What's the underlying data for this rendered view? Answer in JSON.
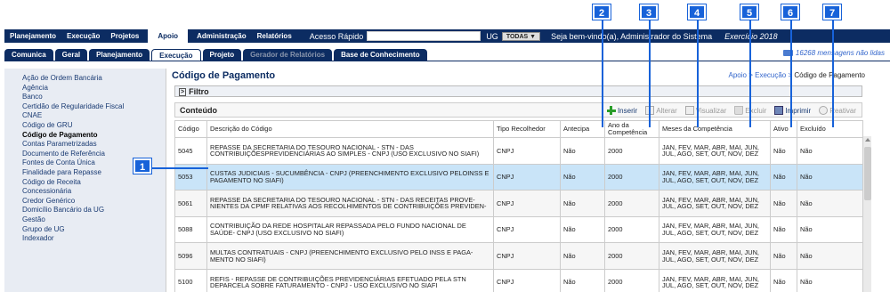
{
  "menu": [
    "Planejamento",
    "Execução",
    "Projetos",
    "Apoio",
    "Administração",
    "Relatórios"
  ],
  "active_menu": "Apoio",
  "quick_access_label": "Acesso Rápido",
  "ug_label": "UG",
  "ug_value": "TODAS ▼",
  "welcome": "Seja bem-vindo(a), Administrador do Sistema",
  "exercise": "Exercício 2018",
  "tabs": [
    "Comunica",
    "Geral",
    "Planejamento",
    "Execução",
    "Projeto",
    "Gerador de Relatórios",
    "Base de Conhecimento"
  ],
  "messages": "16268 mensagens não lidas",
  "sidebar": [
    "Ação de Ordem Bancária",
    "Agência",
    "Banco",
    "Certidão de Regularidade Fiscal",
    "CNAE",
    "Código de GRU",
    "Código de Pagamento",
    "Contas Parametrizadas",
    "Documento de Referência",
    "Fontes de Conta Única",
    "Finalidade para Repasse",
    "Código de Receita",
    "Concessionária",
    "Credor Genérico",
    "Domicílio Bancário da UG",
    "Gestão",
    "Grupo de UG",
    "Indexador"
  ],
  "page_title": "Código de Pagamento",
  "breadcrumb": {
    "p1": "Apoio",
    "sep": " > ",
    "p2": "Execução",
    "p3": "Código de Pagamento"
  },
  "filter_label": "Filtro",
  "content_label": "Conteúdo",
  "actions": [
    "Inserir",
    "Alterar",
    "Visualizar",
    "Excluir",
    "Imprimir",
    "Reativar"
  ],
  "columns": [
    "Código",
    "Descrição do Código",
    "Tipo Recolhedor",
    "Antecipa",
    "Ano da Competência",
    "Meses da Competência",
    "Ativo",
    "Excluído"
  ],
  "rows": [
    [
      "5045",
      "REPASSE DA SECRETARIA DO TESOURO NACIONAL - STN - DAS CONTRIBUIÇÕESPREVIDENCIÁRIAS AO SIMPLES - CNPJ (USO EXCLUSIVO NO SIAFI)",
      "CNPJ",
      "Não",
      "2000",
      "JAN, FEV, MAR, ABR, MAI, JUN, JUL, AGO, SET, OUT, NOV, DEZ",
      "Não",
      "Não"
    ],
    [
      "5053",
      "CUSTAS JUDICIAIS - SUCUMBÊNCIA - CNPJ (PREENCHIMENTO EXCLUSIVO PELOINSS E PAGAMENTO NO SIAFI)",
      "CNPJ",
      "Não",
      "2000",
      "JAN, FEV, MAR, ABR, MAI, JUN, JUL, AGO, SET, OUT, NOV, DEZ",
      "Não",
      "Não"
    ],
    [
      "5061",
      "REPASSE DA SECRETARIA DO TESOURO NACIONAL - STN - DAS RECEITAS PROVE-NIENTES DA CPMF RELATIVAS AOS RECOLHIMENTOS DE CONTRIBUIÇÕES PREVIDEN-",
      "CNPJ",
      "Não",
      "2000",
      "JAN, FEV, MAR, ABR, MAI, JUN, JUL, AGO, SET, OUT, NOV, DEZ",
      "Não",
      "Não"
    ],
    [
      "5088",
      "CONTRIBUIÇÃO DA REDE HOSPITALAR REPASSADA PELO FUNDO NACIONAL DE SAÚDE- CNPJ (USO EXCLUSIVO NO SIAFI)",
      "CNPJ",
      "Não",
      "2000",
      "JAN, FEV, MAR, ABR, MAI, JUN, JUL, AGO, SET, OUT, NOV, DEZ",
      "Não",
      "Não"
    ],
    [
      "5096",
      "MULTAS CONTRATUAIS - CNPJ (PREENCHIMENTO EXCLUSIVO PELO INSS E PAGA-MENTO NO SIAFI)",
      "CNPJ",
      "Não",
      "2000",
      "JAN, FEV, MAR, ABR, MAI, JUN, JUL, AGO, SET, OUT, NOV, DEZ",
      "Não",
      "Não"
    ],
    [
      "5100",
      "REFIS - REPASSE DE CONTRIBUIÇÕES PREVIDENCIÁRIAS EFETUADO PELA STN DEPARCELA SOBRE FATURAMENTO - CNPJ - USO EXCLUSIVO NO SIAFI",
      "CNPJ",
      "Não",
      "2000",
      "JAN, FEV, MAR, ABR, MAI, JUN, JUL, AGO, SET, OUT, NOV, DEZ",
      "Não",
      "Não"
    ]
  ],
  "callouts": [
    "1",
    "2",
    "3",
    "4",
    "5",
    "6",
    "7"
  ],
  "colors": {
    "navy": "#0c2c62",
    "callout": "#1762d9",
    "highlight": "#c9e4f8"
  }
}
